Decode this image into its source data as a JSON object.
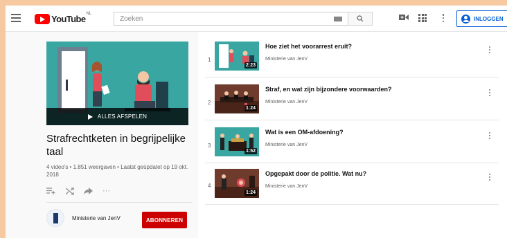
{
  "header": {
    "logo_text": "YouTube",
    "logo_sup": "NL",
    "search_placeholder": "Zoeken",
    "login_label": "INLOGGEN",
    "icons": [
      "menu-icon",
      "keyboard-icon",
      "search-icon",
      "video-camera-icon",
      "apps-icon",
      "more-vert-icon",
      "account-icon"
    ]
  },
  "playlist": {
    "play_all_label": "ALLES AFSPELEN",
    "title": "Strafrechtketen in begrijpelijke taal",
    "meta": "4 video's • 1.851 weergaven • Laatst geüpdatet op 19 okt. 2018",
    "actions": [
      "add-to-queue-icon",
      "shuffle-icon",
      "share-icon",
      "more-horiz-icon"
    ],
    "more_label": "···",
    "owner": "Ministerie van JenV",
    "subscribe_label": "ABONNEREN"
  },
  "videos": [
    {
      "index": "1",
      "title": "Hoe ziet het voorarrest eruit?",
      "channel": "Ministerie van JenV",
      "duration": "2:23",
      "thumb_color": "#3aa6a1"
    },
    {
      "index": "2",
      "title": "Straf, en wat zijn bijzondere voorwaarden?",
      "channel": "Ministerie van JenV",
      "duration": "1:24",
      "thumb_color": "#6e3b2c"
    },
    {
      "index": "3",
      "title": "Wat is een OM-afdoening?",
      "channel": "Ministerie van JenV",
      "duration": "1:52",
      "thumb_color": "#3aa6a1"
    },
    {
      "index": "4",
      "title": "Opgepakt door de politie. Wat nu?",
      "channel": "Ministerie van JenV",
      "duration": "1:24",
      "thumb_color": "#6e3b2c"
    }
  ],
  "colors": {
    "brand_red": "#ff0000",
    "subscribe_red": "#cc0000",
    "link_blue": "#065fd4",
    "page_bg": "#f6c9a0"
  }
}
